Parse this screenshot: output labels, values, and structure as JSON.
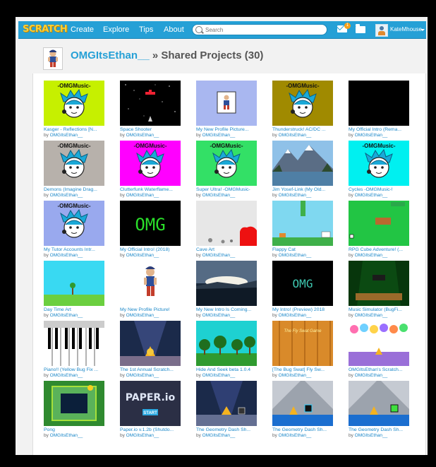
{
  "nav": {
    "logo": "SCRATCH",
    "create": "Create",
    "explore": "Explore",
    "tips": "Tips",
    "about": "About",
    "search_placeholder": "Search",
    "messages_count": "1",
    "username": "KateMhouse"
  },
  "header": {
    "username": "OMGItsEthan__",
    "separator": " » ",
    "title": "Shared Projects (30)"
  },
  "by_prefix": "by ",
  "projects": [
    {
      "title": "Kasger - Reflections [N...",
      "author": "OMGItsEthan__",
      "thumb": "omg-lime"
    },
    {
      "title": "Space Shooter",
      "author": "OMGItsEthan__",
      "thumb": "space"
    },
    {
      "title": "My New Profile Picture...",
      "author": "OMGItsEthan__",
      "thumb": "profile-frame"
    },
    {
      "title": "Thunderstruck! AC/DC ...",
      "author": "OMGItsEthan__",
      "thumb": "omg-olive"
    },
    {
      "title": "My Official Intro (Rema...",
      "author": "OMGItsEthan__",
      "thumb": "black"
    },
    {
      "title": "Demons (Imagine Drag...",
      "author": "OMGItsEthan__",
      "thumb": "omg-gray"
    },
    {
      "title": "Clutterfunk Waterflame...",
      "author": "OMGItsEthan__",
      "thumb": "omg-magenta"
    },
    {
      "title": "Super Ultra! -OMGMusic-",
      "author": "OMGItsEthan__",
      "thumb": "omg-green"
    },
    {
      "title": "Jim Yosef-Link (My Old...",
      "author": "OMGItsEthan__",
      "thumb": "mountain"
    },
    {
      "title": "Cycles -OMGMusic-!",
      "author": "OMGItsEthan__",
      "thumb": "omg-cyan"
    },
    {
      "title": "My Tutor Accounts Intr...",
      "author": "OMGItsEthan__",
      "thumb": "omg-periwinkle"
    },
    {
      "title": "My Official Intro! (2018)",
      "author": "OMGItsEthan__",
      "thumb": "omg-text-green"
    },
    {
      "title": "Cave Art",
      "author": "OMGItsEthan__",
      "thumb": "cave"
    },
    {
      "title": "Flappy Cat",
      "author": "OMGItsEthan__",
      "thumb": "flappy"
    },
    {
      "title": "RPG Cube Adventure! (...",
      "author": "OMGItsEthan__",
      "thumb": "rpg"
    },
    {
      "title": "Day Time Art",
      "author": "OMGItsEthan__",
      "thumb": "daytime"
    },
    {
      "title": "My New Profile Picture!",
      "author": "OMGItsEthan__",
      "thumb": "profile-white"
    },
    {
      "title": "My New Intro Is Coming...",
      "author": "OMGItsEthan__",
      "thumb": "sunset"
    },
    {
      "title": "My Intro! (Preview) 2018",
      "author": "OMGItsEthan__",
      "thumb": "omg-text-dark"
    },
    {
      "title": "Music Simulator (BugFi...",
      "author": "OMGItsEthan__",
      "thumb": "stage"
    },
    {
      "title": "Piano!! (Yellow Bug Fix ...",
      "author": "OMGItsEthan__",
      "thumb": "piano"
    },
    {
      "title": "The 1st Annual Scratch...",
      "author": "OMGItsEthan__",
      "thumb": "spotlight"
    },
    {
      "title": "Hide And Seek beta 1.0.4",
      "author": "OMGItsEthan__",
      "thumb": "forest"
    },
    {
      "title": "[The Bug Swat] Fly Sw...",
      "author": "OMGItsEthan__",
      "thumb": "flyswat"
    },
    {
      "title": "OMGItsEthan's Scratch...",
      "author": "OMGItsEthan__",
      "thumb": "balloons"
    },
    {
      "title": "Pong",
      "author": "OMGItsEthan__",
      "thumb": "pong"
    },
    {
      "title": "Paper.io v.1.2b (Shutdo...",
      "author": "OMGItsEthan__",
      "thumb": "paper"
    },
    {
      "title": "The Geometry Dash Sh...",
      "author": "OMGItsEthan__",
      "thumb": "gd1"
    },
    {
      "title": "The Geometry Dash Sh...",
      "author": "OMGItsEthan__",
      "thumb": "gd2"
    },
    {
      "title": "The Geometry Dash Sh...",
      "author": "OMGItsEthan__",
      "thumb": "gd3"
    }
  ],
  "thumb_text": {
    "omg_music": "-OMGMusic-",
    "omg": "OMG",
    "fly_swat": "The Fly Swat Game",
    "paper": "PAPER.io",
    "start": "START"
  }
}
